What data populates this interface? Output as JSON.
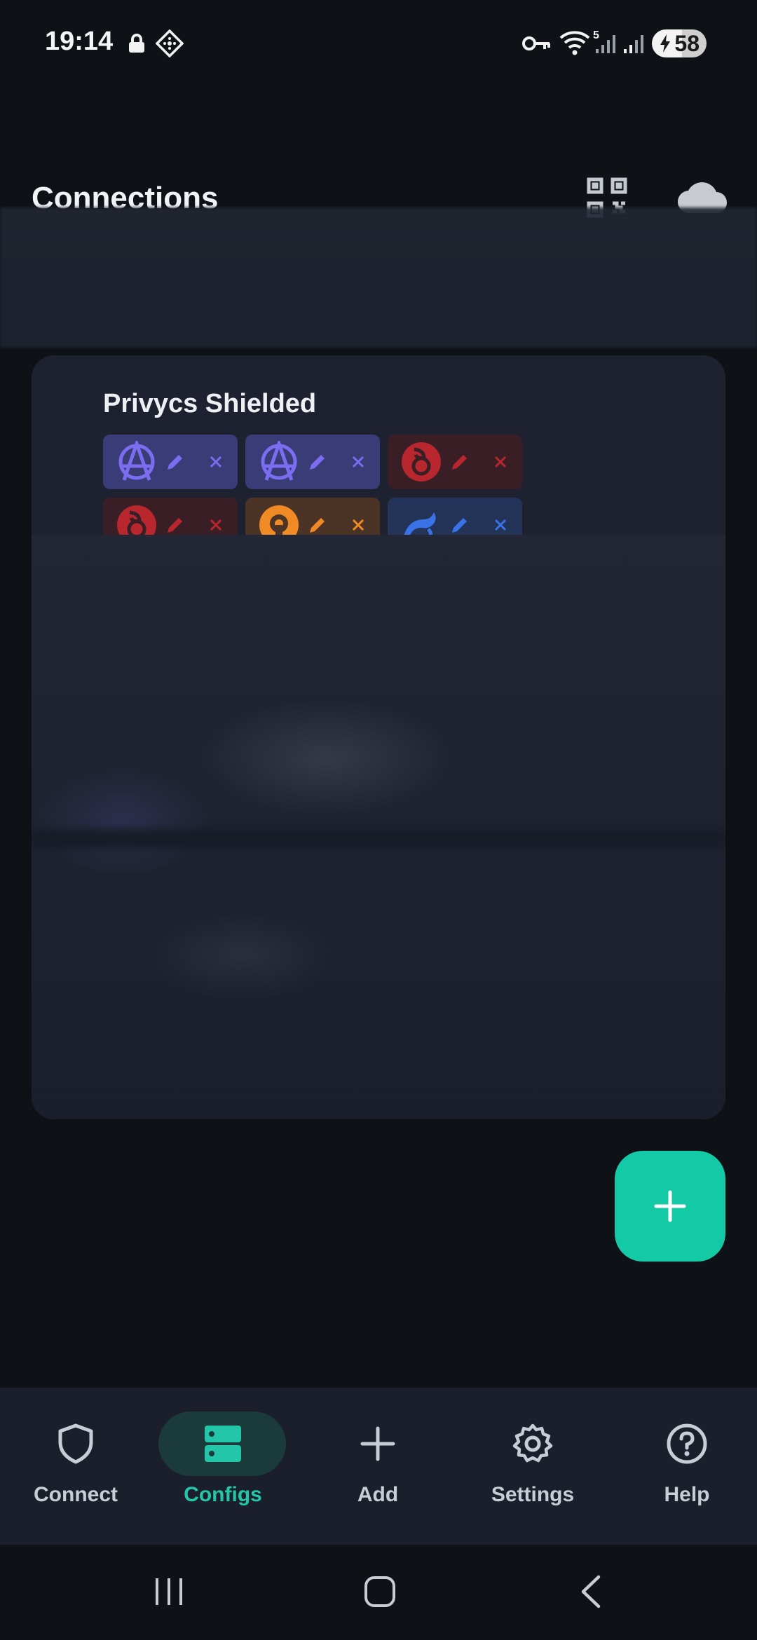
{
  "status_bar": {
    "time": "19:14",
    "battery_level": "58",
    "wifi_badge": "5",
    "icons": [
      "lock-icon",
      "vpn-diamond-icon",
      "key-icon",
      "wifi-icon",
      "signal-icon",
      "signal-icon",
      "battery-icon"
    ]
  },
  "header": {
    "title": "Connections",
    "actions": [
      "qr-code-icon",
      "cloud-icon"
    ]
  },
  "group": {
    "title": "Privycs Shielded",
    "configs": [
      {
        "protocol_icon": "anarchy-icon",
        "color": "#7c6cf0"
      },
      {
        "protocol_icon": "anarchy-icon",
        "color": "#7c6cf0"
      },
      {
        "protocol_icon": "wireguard-icon",
        "color": "#c62832"
      },
      {
        "protocol_icon": "wireguard-icon",
        "color": "#c62832"
      },
      {
        "protocol_icon": "openvpn-icon",
        "color": "#f08a24"
      },
      {
        "protocol_icon": "shadowsocks-icon",
        "color": "#3a72e8"
      }
    ]
  },
  "fab": {
    "icon": "plus-icon",
    "color": "#14c9a6"
  },
  "bottom_nav": {
    "items": [
      {
        "label": "Connect",
        "icon": "shield-icon"
      },
      {
        "label": "Configs",
        "icon": "servers-icon",
        "active": true
      },
      {
        "label": "Add",
        "icon": "plus-icon"
      },
      {
        "label": "Settings",
        "icon": "gear-icon"
      },
      {
        "label": "Help",
        "icon": "help-icon"
      }
    ]
  },
  "system_nav": [
    "recents-button",
    "home-button",
    "back-button"
  ],
  "colors": {
    "accent": "#23c6a8",
    "background": "#0e1217",
    "card": "#1e2230"
  }
}
